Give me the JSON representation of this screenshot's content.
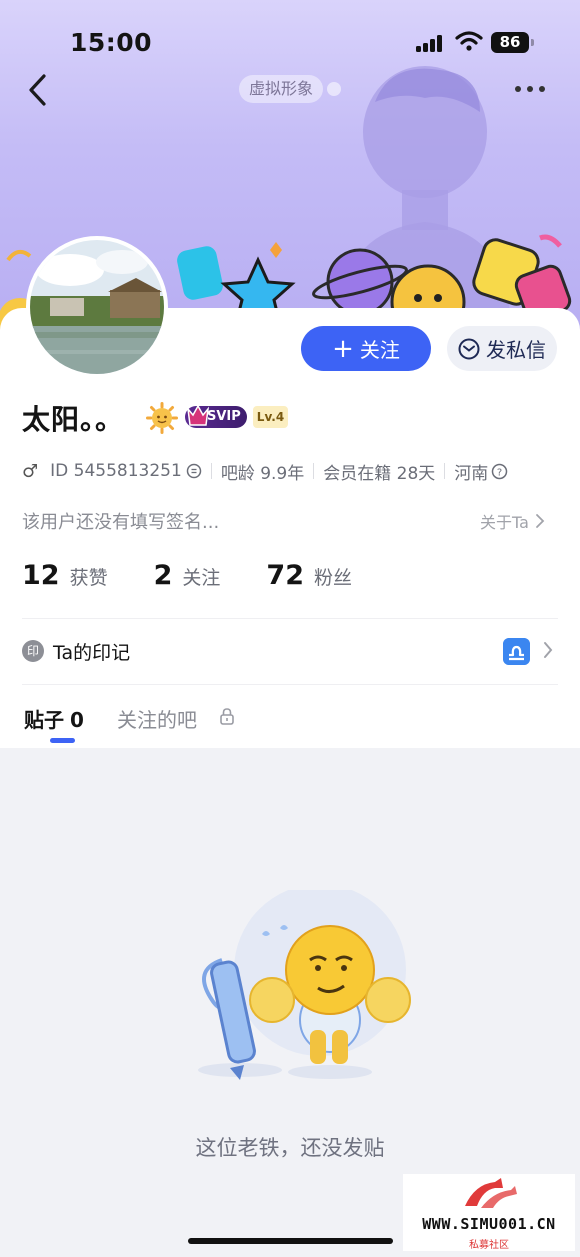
{
  "status_bar": {
    "time": "15:00",
    "battery": "86"
  },
  "header": {
    "avatar_tag": "虚拟形象"
  },
  "profile": {
    "username": "太阳。。",
    "svip_label": "SVIP",
    "level": "Lv.4",
    "gender_symbol": "♂",
    "id_text": "ID 5455813251",
    "tieba_age": "吧龄 9.9年",
    "member_days": "会员在籍 28天",
    "location": "河南",
    "signature": "该用户还没有填写签名...",
    "about_label": "关于Ta"
  },
  "actions": {
    "follow_label": "关注",
    "message_label": "发私信"
  },
  "stats": [
    {
      "value": "12",
      "label": "获赞"
    },
    {
      "value": "2",
      "label": "关注"
    },
    {
      "value": "72",
      "label": "粉丝"
    }
  ],
  "seal": {
    "icon_text": "印",
    "label": "Ta的印记"
  },
  "tabs": {
    "posts_label": "贴子",
    "posts_count": "0",
    "bars_label": "关注的吧"
  },
  "empty_state": {
    "message": "这位老铁，还没发贴"
  },
  "watermark": {
    "site": "WWW.SIMU001.CN",
    "sub": "私募社区"
  },
  "colors": {
    "accent": "#3d63f5",
    "banner": "#c4bcf6",
    "svip": "#5a2a92"
  }
}
